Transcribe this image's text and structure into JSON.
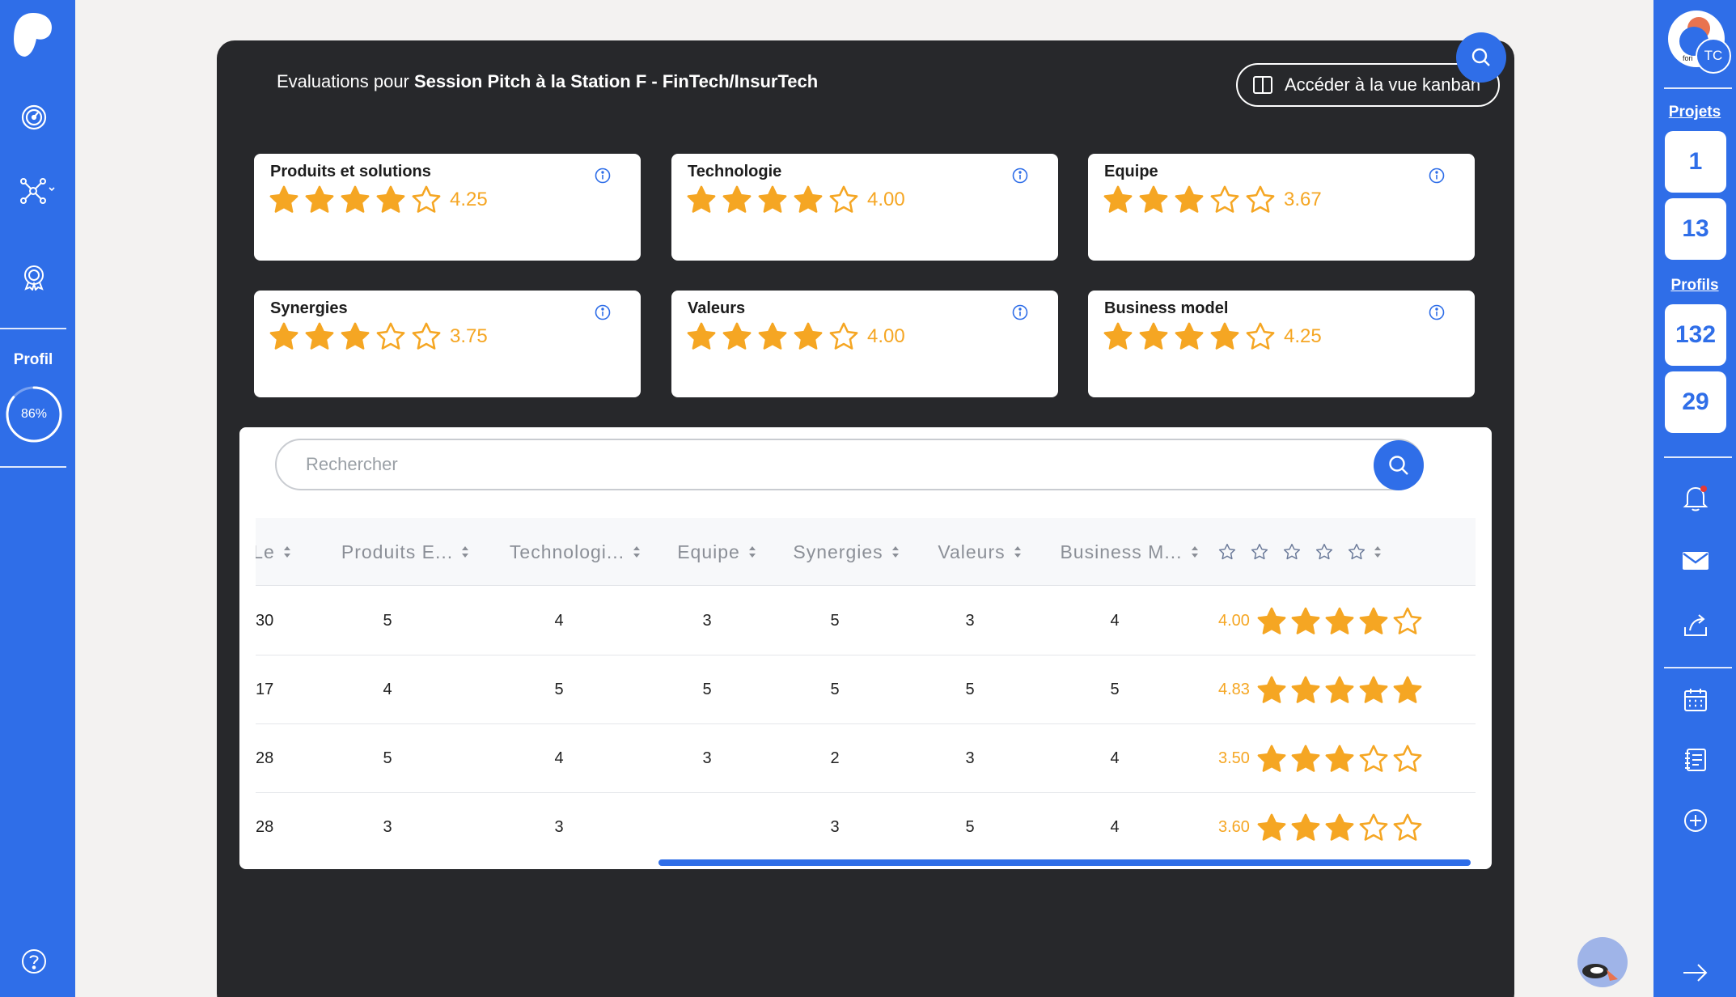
{
  "left_sidebar": {
    "profil_label": "Profil",
    "profile_progress": 86,
    "profile_progress_text": "86%"
  },
  "right_sidebar": {
    "avatar_initials": "TC",
    "avatar_brand_text": "fori",
    "projets_label": "Projets",
    "projets_counts": [
      "1",
      "13"
    ],
    "profils_label": "Profils",
    "profils_counts": [
      "132",
      "29"
    ],
    "notification_dot_color": "#e53935"
  },
  "header": {
    "title_prefix": "Evaluations pour ",
    "title_bold": "Session Pitch à la Station F - FinTech/InsurTech",
    "kanban_button": "Accéder à la vue kanban"
  },
  "criteria_cards": [
    {
      "title": "Produits et solutions",
      "rating": 4.25,
      "value": "4.25"
    },
    {
      "title": "Technologie",
      "rating": 4.0,
      "value": "4.00"
    },
    {
      "title": "Equipe",
      "rating": 3.67,
      "value": "3.67"
    },
    {
      "title": "Synergies",
      "rating": 3.75,
      "value": "3.75"
    },
    {
      "title": "Valeurs",
      "rating": 4.0,
      "value": "4.00"
    },
    {
      "title": "Business model",
      "rating": 4.25,
      "value": "4.25"
    }
  ],
  "search": {
    "placeholder": "Rechercher"
  },
  "table": {
    "columns": [
      "Le",
      "Produits E...",
      "Technologi...",
      "Equipe",
      "Synergies",
      "Valeurs",
      "Business M...",
      ""
    ],
    "rows": [
      {
        "first": "30",
        "produits": "5",
        "technologie": "4",
        "equipe": "3",
        "synergies": "5",
        "valeurs": "3",
        "business": "4",
        "rating": 4.0,
        "rating_text": "4.00"
      },
      {
        "first": "17",
        "produits": "4",
        "technologie": "5",
        "equipe": "5",
        "synergies": "5",
        "valeurs": "5",
        "business": "5",
        "rating": 4.83,
        "rating_text": "4.83"
      },
      {
        "first": "28",
        "produits": "5",
        "technologie": "4",
        "equipe": "3",
        "synergies": "2",
        "valeurs": "3",
        "business": "4",
        "rating": 3.5,
        "rating_text": "3.50"
      },
      {
        "first": "28",
        "produits": "3",
        "technologie": "3",
        "equipe": "",
        "synergies": "3",
        "valeurs": "5",
        "business": "4",
        "rating": 3.6,
        "rating_text": "3.60"
      }
    ]
  },
  "colors": {
    "brand_blue": "#2f6ee8",
    "star_gold": "#f5a623",
    "panel_dark": "#27282b"
  }
}
